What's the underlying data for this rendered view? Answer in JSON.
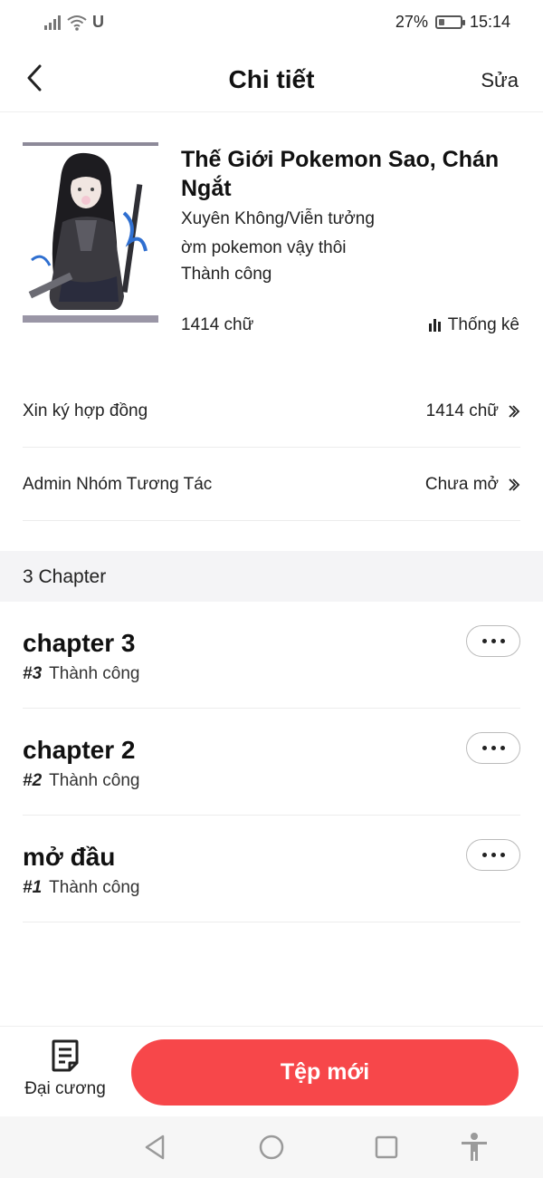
{
  "status_bar": {
    "battery": "27%",
    "time": "15:14",
    "carrier_glyph": "U",
    "battery_level": 0.27,
    "icons": [
      "signal-icon",
      "wifi-icon",
      "battery-icon"
    ]
  },
  "header": {
    "title": "Chi tiết",
    "edit_label": "Sửa",
    "back_icon": "chevron-left-icon"
  },
  "book": {
    "title": "Thế Giới Pokemon Sao, Chán Ngắt",
    "genre": "Xuyên Không/Viễn tưởng",
    "description": "ờm pokemon vậy thôi",
    "status": "Thành công",
    "word_count": "1414 chữ",
    "stats_label": "Thống kê"
  },
  "rows": [
    {
      "label": "Xin ký hợp đồng",
      "value": "1414 chữ"
    },
    {
      "label": "Admin Nhóm Tương Tác",
      "value": "Chưa mở"
    }
  ],
  "chapters_header": "3 Chapter",
  "chapters": [
    {
      "title": "chapter 3",
      "number": "#3",
      "status": "Thành công"
    },
    {
      "title": "chapter 2",
      "number": "#2",
      "status": "Thành công"
    },
    {
      "title": "mở đầu",
      "number": "#1",
      "status": "Thành công"
    }
  ],
  "bottom": {
    "outline_label": "Đại cương",
    "new_file_label": "Tệp mới",
    "accent_color": "#f7474a"
  },
  "nav": {
    "icons": [
      "back-triangle-icon",
      "home-circle-icon",
      "recents-square-icon",
      "accessibility-icon"
    ]
  }
}
